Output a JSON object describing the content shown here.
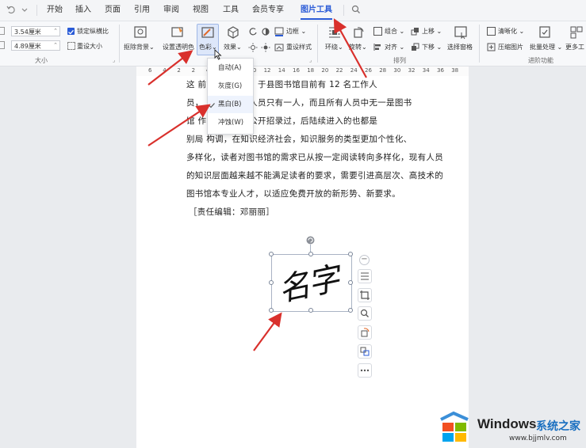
{
  "menu": {
    "tabs": [
      "开始",
      "插入",
      "页面",
      "引用",
      "审阅",
      "视图",
      "工具",
      "会员专享",
      "图片工具"
    ],
    "active_tab": "图片工具"
  },
  "ribbon": {
    "size_group": {
      "height_value": "3.54厘米",
      "width_value": "4.89厘米",
      "lock_ratio_label": "锁定纵横比",
      "reset_size_label": "重设大小",
      "group_label": "大小"
    },
    "buttons": {
      "remove_bg": "抠除背景",
      "set_transparent": "设置透明色",
      "color": "色彩",
      "effects": "效果",
      "border": "边框",
      "reset_style": "重设样式",
      "wrap": "环绕",
      "rotate": "旋转",
      "group": "组合",
      "align": "对齐",
      "bring_up": "上移",
      "send_down": "下移",
      "selection_pane": "选择窗格",
      "sharpen": "清晰化",
      "compress": "压缩图片",
      "batch": "批量处理",
      "more": "更多工"
    },
    "group_labels": {
      "arrange": "排列",
      "advanced": "进阶功能"
    }
  },
  "color_dropdown": {
    "items": [
      "自动(A)",
      "灰度(G)",
      "黑白(B)",
      "冲蚀(W)"
    ],
    "selected": "黑白(B)"
  },
  "ruler": {
    "numbers": [
      "6",
      "4",
      "2",
      "2",
      "4",
      "6",
      "8",
      "10",
      "12",
      "14",
      "16",
      "18",
      "20",
      "22",
      "24",
      "26",
      "28",
      "30",
      "32",
      "34",
      "36",
      "38"
    ]
  },
  "document": {
    "lines": [
      "这                    前的开展问题，于县图书馆目前有 12 名工作人",
      "员，                  图书馆专业人员只有一人，而且所有人员中无一是图书",
      "馆                    作以来，没有公开招录过，后陆续进入的也都是",
      "别局                  构调，在知识经济社会，知识服务的类型更加个性化、",
      "多样化，读者对图书馆的需求已从按一定阅读转向多样化，现有人员",
      "的知识层面越来越不能满足读者的要求，需要引进高层次、高技术的",
      "图书馆本专业人才，以适应免费开放的新形势、新要求。",
      "［责任编辑：邓丽丽］"
    ]
  },
  "signature_text": "名字",
  "watermark": {
    "title": "Windows",
    "subtitle": "系统之家",
    "url": "www.bjjmlv.com"
  },
  "colors": {
    "accent": "#2a5bd7",
    "annotation_arrow": "#d9302c"
  }
}
